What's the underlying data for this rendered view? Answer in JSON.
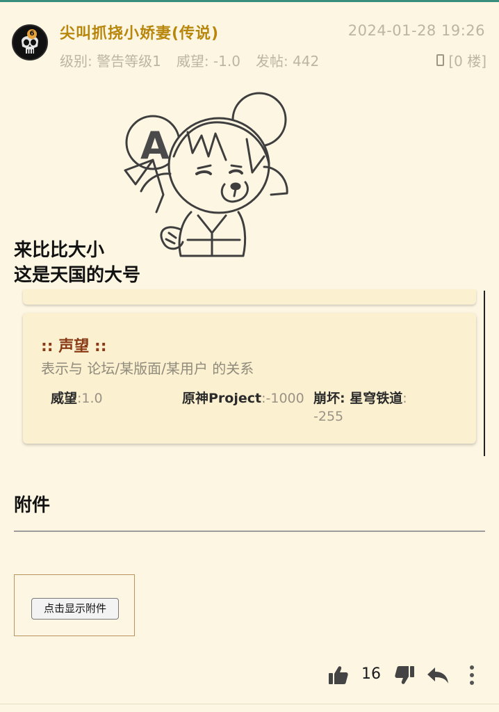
{
  "header": {
    "avatar_badge": "6",
    "username": "尖叫抓挠小娇妻(传说)",
    "post_time": "2024-01-28 19:26",
    "level": "级别: 警告等级1",
    "prestige": "威望: -1.0",
    "posts": "发帖: 442",
    "floor": "[0 楼]"
  },
  "content": {
    "line1": "来比比大小",
    "line2": "这是天国的大号"
  },
  "reputation_card": {
    "title": ":: 声望 ::",
    "subtitle": "表示与 论坛/某版面/某用户 的关系",
    "items": [
      {
        "label": "威望",
        "value": ":1.0"
      },
      {
        "label": "原神Project",
        "value": ":-1000"
      },
      {
        "label": "崩坏: 星穹铁道",
        "value": ":"
      },
      {
        "value_wrap": "-255"
      }
    ]
  },
  "attachments": {
    "heading": "附件",
    "show_button": "点击显示附件"
  },
  "actions": {
    "like_count": "16",
    "icons": [
      "thumbs-up-icon",
      "thumbs-down-icon",
      "reply-icon",
      "more-vertical-icon"
    ]
  },
  "colors": {
    "background": "#fdf6e3",
    "username": "#b8860b",
    "meta_text": "#bdb5a3",
    "card_bg": "#fbf0d0",
    "card_title": "#8b3a16",
    "accent_top": "#3a8f7c"
  }
}
